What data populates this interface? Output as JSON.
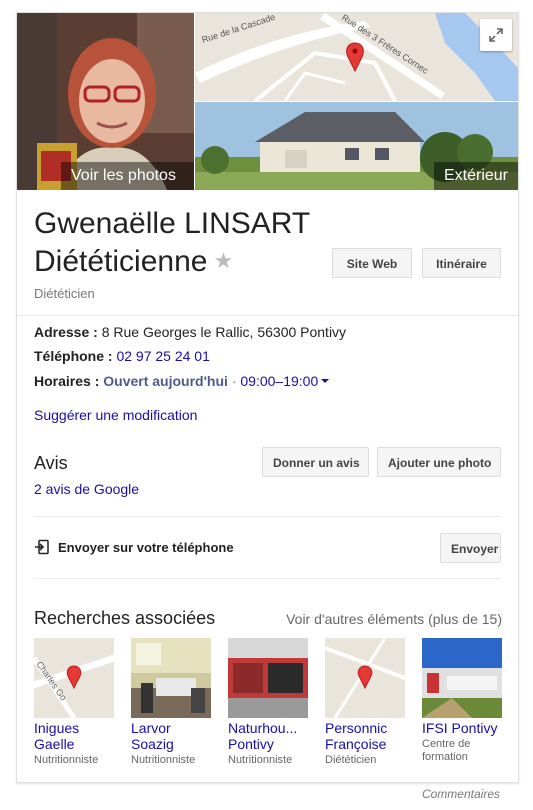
{
  "photos": {
    "main_label": "Voir les photos",
    "exterior_label": "Extérieur",
    "map_streets": [
      "Rue de la Cascade",
      "Rue des 3 Frères Cornec"
    ]
  },
  "business": {
    "name": "Gwenaëlle LINSART",
    "name_line2": "Diététicienne",
    "category": "Diététicien",
    "website_button": "Site Web",
    "directions_button": "Itinéraire"
  },
  "info": {
    "address_label": "Adresse :",
    "address_value": "8 Rue Georges le Rallic, 56300 Pontivy",
    "phone_label": "Téléphone :",
    "phone_value": "02 97 25 24 01",
    "hours_label": "Horaires :",
    "hours_status": "Ouvert aujourd'hui",
    "hours_separator": "·",
    "hours_value": "09:00–19:00",
    "suggest_edit": "Suggérer une modification"
  },
  "reviews": {
    "title": "Avis",
    "count_link": "2 avis de Google",
    "write_review_button": "Donner un avis",
    "add_photo_button": "Ajouter une photo"
  },
  "send": {
    "label": "Envoyer sur votre téléphone",
    "button": "Envoyer"
  },
  "related": {
    "title": "Recherches associées",
    "more_link": "Voir d'autres éléments (plus de 15)",
    "items": [
      {
        "name_line1": "Inigues",
        "name_line2": "Gaelle",
        "category": "Nutritionniste",
        "map_street": "Charles Go"
      },
      {
        "name_line1": "Larvor",
        "name_line2": "Soazig",
        "category": "Nutritionniste"
      },
      {
        "name_line1": "Naturhou...",
        "name_line2": "Pontivy",
        "category": "Nutritionniste"
      },
      {
        "name_line1": "Personnic",
        "name_line2": "Françoise",
        "category": "Diététicien"
      },
      {
        "name_line1": "IFSI Pontivy",
        "name_line2": "",
        "category_line1": "Centre de",
        "category_line2": "formation"
      }
    ]
  },
  "footer": {
    "feedback": "Commentaires"
  },
  "colors": {
    "link": "#1a0dab",
    "open_status": "#505a8f",
    "map_pin": "#e53935"
  }
}
